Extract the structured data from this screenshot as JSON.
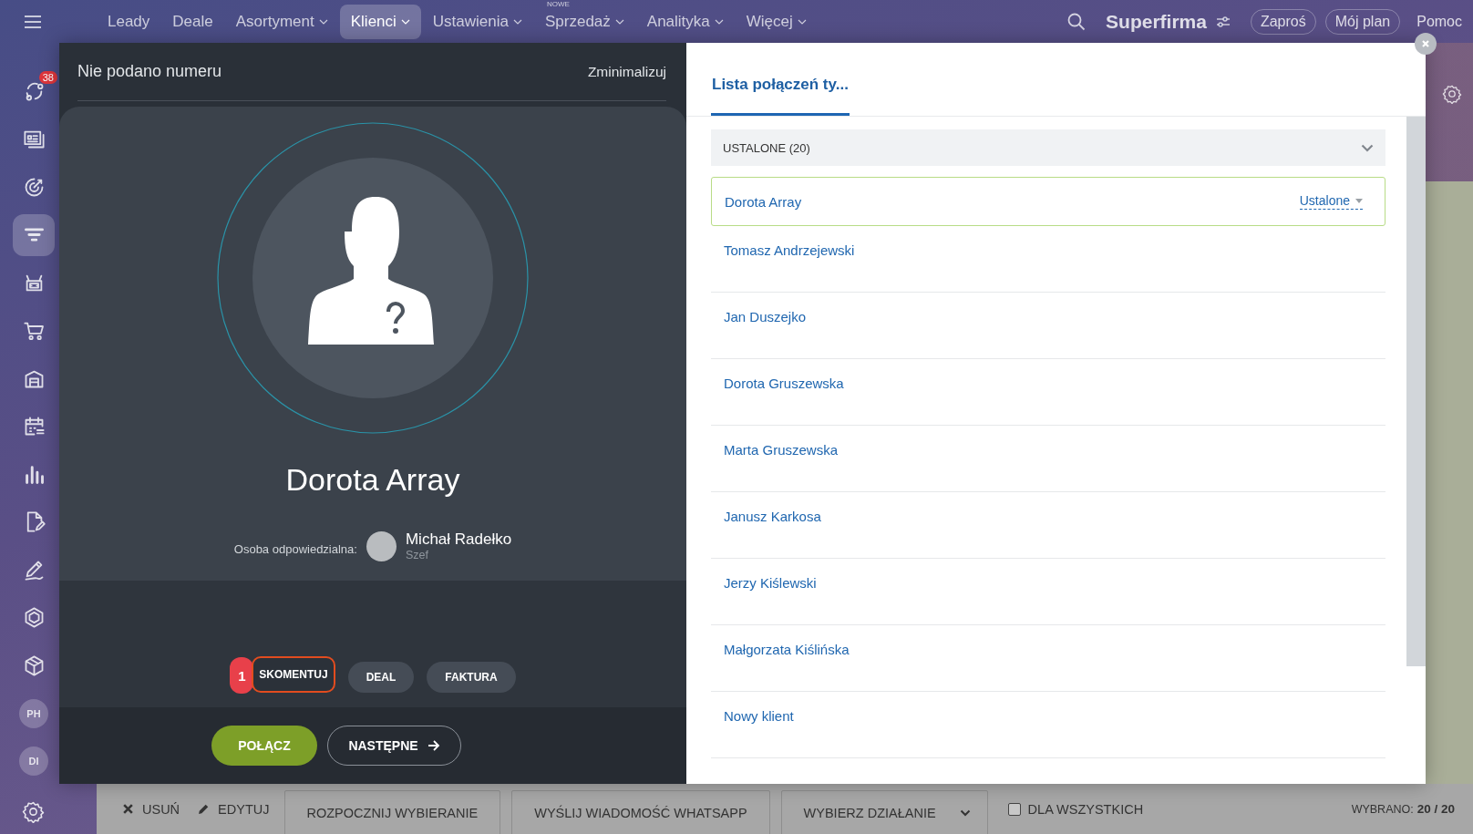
{
  "nav": {
    "items": [
      {
        "label": "Leady",
        "dropdown": false,
        "selected": false
      },
      {
        "label": "Deale",
        "dropdown": false,
        "selected": false
      },
      {
        "label": "Asortyment",
        "dropdown": true,
        "selected": false
      },
      {
        "label": "Klienci",
        "dropdown": true,
        "selected": true
      },
      {
        "label": "Ustawienia",
        "dropdown": true,
        "selected": false
      },
      {
        "label": "Sprzedaż",
        "dropdown": true,
        "selected": false,
        "badge": "NOWE"
      },
      {
        "label": "Analityka",
        "dropdown": true,
        "selected": false
      },
      {
        "label": "Więcej",
        "dropdown": true,
        "selected": false
      }
    ],
    "company": "Superfirma",
    "buttons": [
      "Zaproś",
      "Mój plan"
    ],
    "help": "Pomoc"
  },
  "sidebar": {
    "items": [
      {
        "kind": "icon",
        "selected": false,
        "badge": "38"
      },
      {
        "kind": "icon",
        "selected": false
      },
      {
        "kind": "icon",
        "selected": false
      },
      {
        "kind": "icon",
        "selected": true
      },
      {
        "kind": "icon",
        "selected": false
      },
      {
        "kind": "icon",
        "selected": false
      },
      {
        "kind": "icon",
        "selected": false
      },
      {
        "kind": "icon",
        "selected": false
      },
      {
        "kind": "icon",
        "selected": false
      },
      {
        "kind": "icon",
        "selected": false
      },
      {
        "kind": "icon",
        "selected": false
      },
      {
        "kind": "icon",
        "selected": false
      },
      {
        "kind": "icon",
        "selected": false
      },
      {
        "kind": "avatar",
        "selected": false,
        "initials": "PH"
      },
      {
        "kind": "avatar",
        "selected": false,
        "initials": "DI"
      }
    ]
  },
  "call_panel": {
    "title": "Nie podano numeru",
    "minimize": "Zminimalizuj",
    "contact_name": "Dorota Array",
    "responsible_label": "Osoba odpowiedzialna:",
    "responsible_name": "Michał Radełko",
    "responsible_role": "Szef",
    "actions": [
      {
        "label": "SKOMENTUJ",
        "highlighted": true,
        "step": "1"
      },
      {
        "label": "DEAL",
        "highlighted": false
      },
      {
        "label": "FAKTURA",
        "highlighted": false
      }
    ],
    "call_button": "POŁĄCZ",
    "next_button": "NASTĘPNE"
  },
  "call_list": {
    "tabs": [
      {
        "label": "Lista połączeń ty...",
        "selected": true
      }
    ],
    "group": {
      "label": "USTALONE (20)",
      "expanded": true
    },
    "items": [
      {
        "name": "Dorota Array",
        "selected": true,
        "status": "Ustalone"
      },
      {
        "name": "Tomasz Andrzejewski",
        "selected": false
      },
      {
        "name": "Jan Duszejko",
        "selected": false
      },
      {
        "name": "Dorota Gruszewska",
        "selected": false
      },
      {
        "name": "Marta Gruszewska",
        "selected": false
      },
      {
        "name": "Janusz Karkosa",
        "selected": false
      },
      {
        "name": "Jerzy Kiślewski",
        "selected": false
      },
      {
        "name": "Małgorzata Kiślińska",
        "selected": false
      },
      {
        "name": "Nowy klient",
        "selected": false
      }
    ]
  },
  "bottom_bar": {
    "actions": [
      {
        "kind": "delete",
        "label": "USUŃ"
      },
      {
        "kind": "edit",
        "label": "EDYTUJ"
      },
      {
        "kind": "button",
        "label": "ROZPOCZNIJ WYBIERANIE"
      },
      {
        "kind": "button",
        "label": "WYŚLIJ WIADOMOŚĆ WHATSAPP"
      },
      {
        "kind": "dropdown",
        "label": "WYBIERZ DZIAŁANIE"
      }
    ],
    "apply_all": {
      "label": "DLA WSZYSTKICH",
      "checked": false
    },
    "selected_label": "WYBRANO:",
    "selected_count": "20 / 20"
  }
}
